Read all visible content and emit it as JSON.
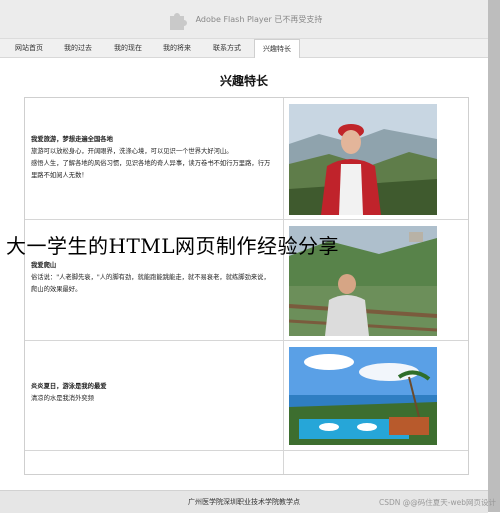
{
  "flash": {
    "icon": "puzzle-icon",
    "message": "Adobe Flash Player 已不再受支持"
  },
  "nav": {
    "items": [
      {
        "label": "网站首页"
      },
      {
        "label": "我的过去"
      },
      {
        "label": "我的现在"
      },
      {
        "label": "我的将来"
      },
      {
        "label": "联系方式"
      },
      {
        "label": "兴趣特长",
        "active": true
      }
    ]
  },
  "page": {
    "title": "兴趣特长"
  },
  "sections": [
    {
      "heading": "我爱旅游，梦想走遍全国各地",
      "lines": [
        "旅游可以放松身心，开阔眼界，洗涤心境，可以见识一个世界大好河山。",
        "感悟人生，了解各地的风俗习惯，见识各地的奇人异事，读万卷书不如行万里路，行万",
        "里路不如阅人无数！"
      ]
    },
    {
      "heading": "我爱爬山",
      "lines": [
        "俗话说：\"人老脚先衰，\"人的脚有劲，就能跑能跳能走，就不易衰老，就练脚劲来说，",
        "爬山的效果最好。"
      ]
    },
    {
      "heading": "炎炎夏日，游泳是我的最爱",
      "lines": [
        "清凉的水是我消外奕频"
      ]
    }
  ],
  "overlay": {
    "text": "大一学生的HTML网页制作经验分享"
  },
  "footer": {
    "text": "广州医学院深圳职业技术学院教学点"
  },
  "credit": {
    "text": "CSDN @@码住夏天-web网页设计"
  }
}
